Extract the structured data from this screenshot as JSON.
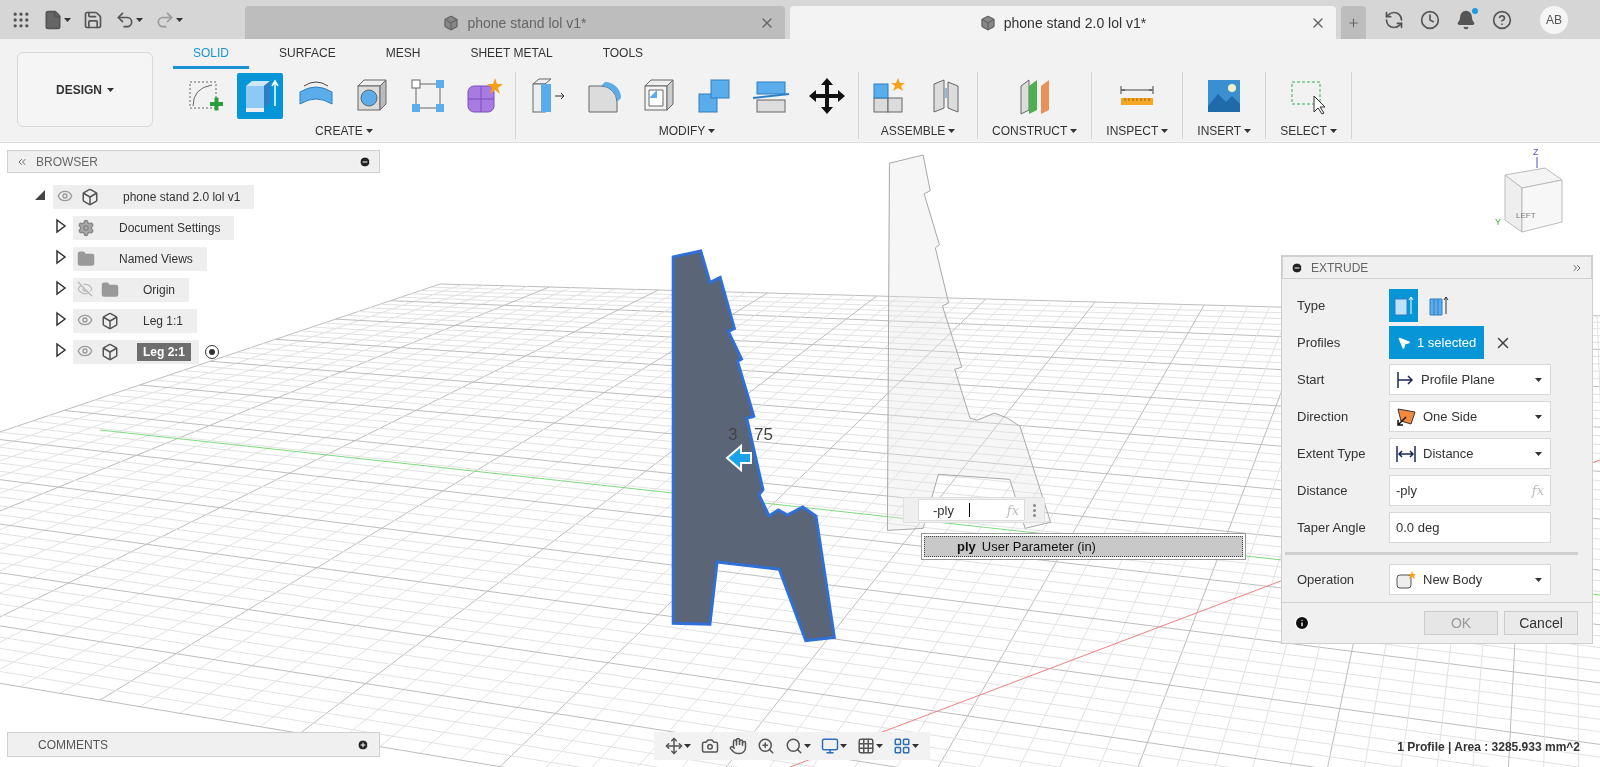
{
  "doc_tabs": [
    {
      "title": "phone stand lol v1*",
      "selected": false
    },
    {
      "title": "phone stand 2.0 lol v1*",
      "selected": true
    }
  ],
  "user": {
    "initials": "AB"
  },
  "workspace": {
    "label": "DESIGN"
  },
  "toolbar_tabs": [
    {
      "label": "SOLID",
      "selected": true
    },
    {
      "label": "SURFACE",
      "selected": false
    },
    {
      "label": "MESH",
      "selected": false
    },
    {
      "label": "SHEET METAL",
      "selected": false
    },
    {
      "label": "TOOLS",
      "selected": false
    }
  ],
  "tool_groups": [
    {
      "label": "CREATE",
      "tools": [
        {
          "kind": "sketch",
          "selected": false
        },
        {
          "kind": "extrude",
          "selected": true
        },
        {
          "kind": "revolve",
          "selected": false
        },
        {
          "kind": "hole",
          "selected": false
        },
        {
          "kind": "pattern",
          "selected": false
        },
        {
          "kind": "form",
          "selected": false
        }
      ]
    },
    {
      "label": "MODIFY",
      "tools": [
        {
          "kind": "presspull",
          "selected": false
        },
        {
          "kind": "fillet",
          "selected": false
        },
        {
          "kind": "shell",
          "selected": false
        },
        {
          "kind": "combine",
          "selected": false
        },
        {
          "kind": "split",
          "selected": false
        },
        {
          "kind": "move",
          "selected": false
        }
      ]
    },
    {
      "label": "ASSEMBLE",
      "tools": [
        {
          "kind": "component",
          "selected": false
        },
        {
          "kind": "joint",
          "selected": false
        }
      ]
    },
    {
      "label": "CONSTRUCT",
      "tools": [
        {
          "kind": "plane",
          "selected": false
        }
      ]
    },
    {
      "label": "INSPECT",
      "tools": [
        {
          "kind": "measure",
          "selected": false
        }
      ]
    },
    {
      "label": "INSERT",
      "tools": [
        {
          "kind": "image",
          "selected": false
        }
      ]
    },
    {
      "label": "SELECT",
      "tools": [
        {
          "kind": "select",
          "selected": false
        }
      ]
    }
  ],
  "browser": {
    "title": "BROWSER",
    "root": {
      "label": "phone stand 2.0 lol v1",
      "visible": true,
      "expanded": true,
      "children": [
        {
          "label": "Document Settings",
          "kind": "settings",
          "expanded": false,
          "selected": false
        },
        {
          "label": "Named Views",
          "kind": "folder",
          "expanded": false,
          "selected": false
        },
        {
          "label": "Origin",
          "kind": "folder",
          "visible": false,
          "expanded": false,
          "selected": false
        },
        {
          "label": "Leg 1:1",
          "kind": "body",
          "visible": true,
          "expanded": false,
          "selected": false,
          "active": false
        },
        {
          "label": "Leg 2:1",
          "kind": "body",
          "visible": true,
          "expanded": false,
          "selected": true,
          "active": true
        }
      ]
    }
  },
  "viewport": {
    "dimension_parts": [
      "3",
      "75"
    ],
    "input": {
      "value": "-ply",
      "hint": "fx"
    },
    "suggestion": {
      "name": "ply",
      "description": "User Parameter (in)"
    },
    "view_cube": {
      "face": "LEFT",
      "axes": [
        "Z",
        "Y"
      ]
    }
  },
  "extrude": {
    "title": "EXTRUDE",
    "rows": [
      {
        "label": "Type",
        "kind": "type",
        "options": [
          {
            "kind": "solid",
            "selected": true
          },
          {
            "kind": "surface",
            "selected": false
          }
        ]
      },
      {
        "label": "Profiles",
        "kind": "selection",
        "value": "1 selected"
      },
      {
        "label": "Start",
        "kind": "dropdown",
        "value": "Profile Plane"
      },
      {
        "label": "Direction",
        "kind": "dropdown",
        "value": "One Side"
      },
      {
        "label": "Extent Type",
        "kind": "dropdown",
        "value": "Distance"
      },
      {
        "label": "Distance",
        "kind": "expression",
        "value": "-ply",
        "hint": "fx"
      },
      {
        "label": "Taper Angle",
        "kind": "text",
        "value": "0.0 deg"
      },
      {
        "kind": "separator"
      },
      {
        "label": "Operation",
        "kind": "dropdown",
        "value": "New Body"
      }
    ],
    "buttons": [
      {
        "label": "OK",
        "disabled": true
      },
      {
        "label": "Cancel",
        "disabled": false
      }
    ]
  },
  "comments": {
    "title": "COMMENTS"
  },
  "status": "1 Profile | Area : 3285.933 mm^2"
}
